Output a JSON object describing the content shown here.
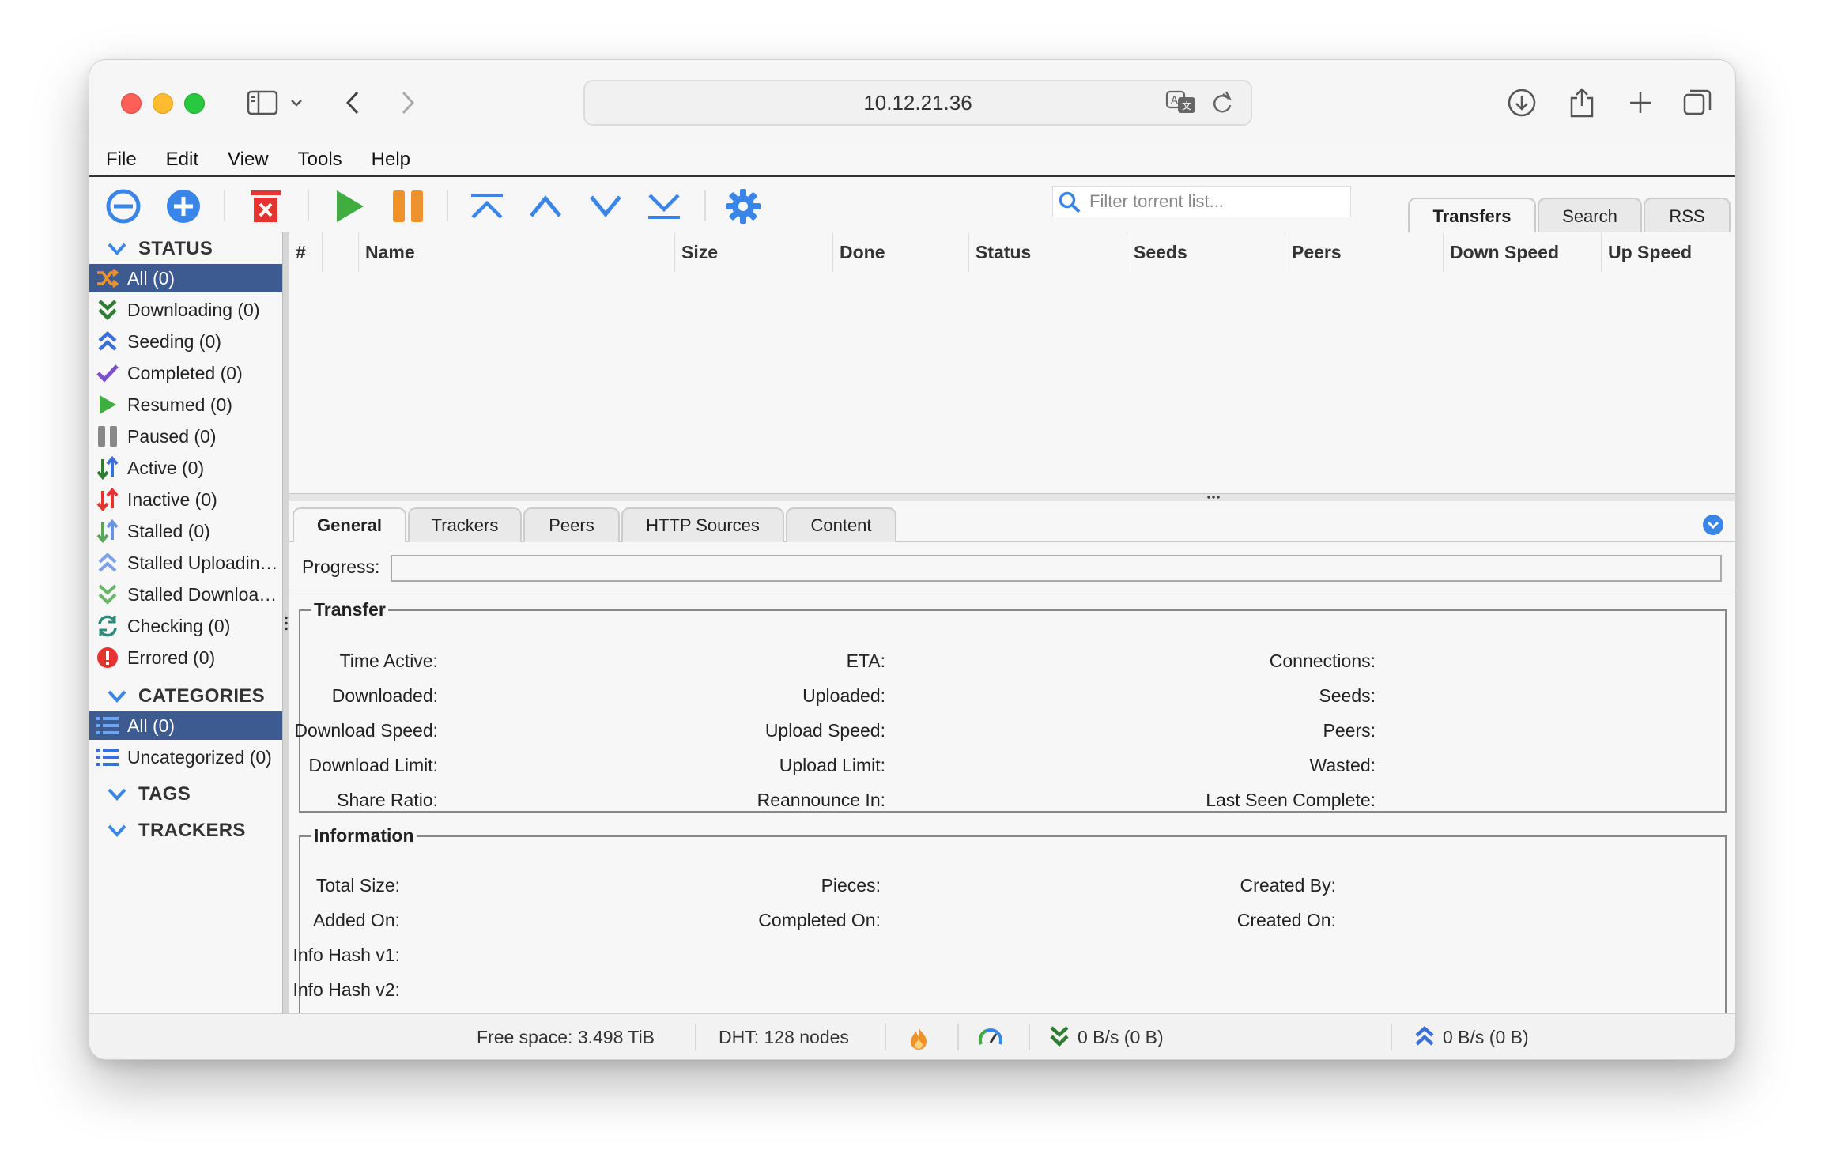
{
  "browser": {
    "address": "10.12.21.36"
  },
  "menu": [
    "File",
    "Edit",
    "View",
    "Tools",
    "Help"
  ],
  "toolbar": {
    "filter_placeholder": "Filter torrent list...",
    "tabs": [
      "Transfers",
      "Search",
      "RSS"
    ],
    "active_tab": "Transfers"
  },
  "sidebar": {
    "status_header": "STATUS",
    "status_items": [
      {
        "label": "All (0)",
        "icon": "shuffle-icon"
      },
      {
        "label": "Downloading (0)",
        "icon": "double-chevron-down-icon"
      },
      {
        "label": "Seeding (0)",
        "icon": "double-chevron-up-icon"
      },
      {
        "label": "Completed (0)",
        "icon": "checkmark-icon"
      },
      {
        "label": "Resumed (0)",
        "icon": "play-icon"
      },
      {
        "label": "Paused (0)",
        "icon": "pause-icon"
      },
      {
        "label": "Active (0)",
        "icon": "updown-arrows-icon"
      },
      {
        "label": "Inactive (0)",
        "icon": "updown-arrows-icon"
      },
      {
        "label": "Stalled (0)",
        "icon": "updown-arrows-icon"
      },
      {
        "label": "Stalled Uploading (0)",
        "icon": "double-chevron-up-icon"
      },
      {
        "label": "Stalled Downloading (0)",
        "icon": "double-chevron-down-icon"
      },
      {
        "label": "Checking (0)",
        "icon": "refresh-icon"
      },
      {
        "label": "Errored (0)",
        "icon": "error-icon"
      }
    ],
    "categories_header": "CATEGORIES",
    "category_items": [
      {
        "label": "All (0)",
        "icon": "list-icon"
      },
      {
        "label": "Uncategorized (0)",
        "icon": "list-icon"
      }
    ],
    "tags_header": "TAGS",
    "trackers_header": "TRACKERS"
  },
  "list": {
    "columns": [
      "#",
      "",
      "Name",
      "Size",
      "Done",
      "Status",
      "Seeds",
      "Peers",
      "Down Speed",
      "Up Speed"
    ]
  },
  "properties": {
    "tabs": [
      "General",
      "Trackers",
      "Peers",
      "HTTP Sources",
      "Content"
    ],
    "active_tab": "General",
    "progress_label": "Progress:",
    "transfer": {
      "title": "Transfer",
      "col1": [
        "Time Active:",
        "Downloaded:",
        "Download Speed:",
        "Download Limit:",
        "Share Ratio:"
      ],
      "col2": [
        "ETA:",
        "Uploaded:",
        "Upload Speed:",
        "Upload Limit:",
        "Reannounce In:"
      ],
      "col3": [
        "Connections:",
        "Seeds:",
        "Peers:",
        "Wasted:",
        "Last Seen Complete:"
      ]
    },
    "information": {
      "title": "Information",
      "col1": [
        "Total Size:",
        "Added On:",
        "Info Hash v1:",
        "Info Hash v2:"
      ],
      "col2": [
        "Pieces:",
        "Completed On:"
      ],
      "col3": [
        "Created By:",
        "Created On:"
      ]
    }
  },
  "statusbar": {
    "free_space": "Free space: 3.498 TiB",
    "dht": "DHT: 128 nodes",
    "download": "0 B/s (0 B)",
    "upload": "0 B/s (0 B)"
  },
  "colors": {
    "accent_blue": "#3a86e8",
    "selected_row": "#3d5a91",
    "green": "#3fae3f",
    "orange": "#f0922b",
    "red": "#e3342f"
  }
}
